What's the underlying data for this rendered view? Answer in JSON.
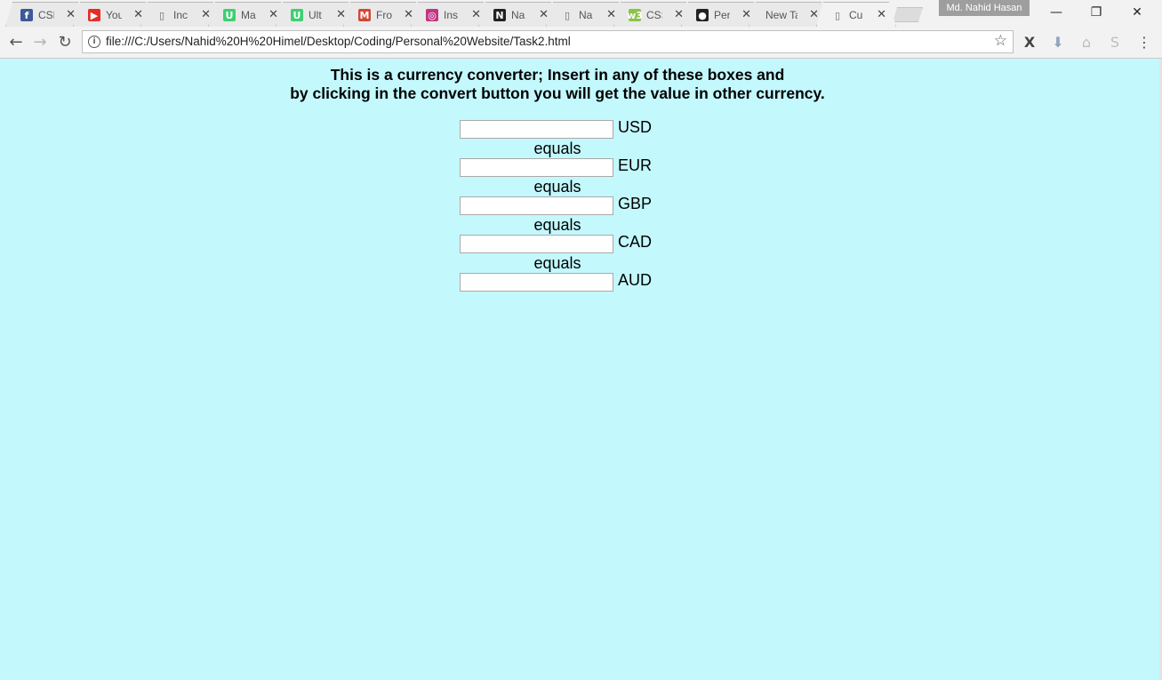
{
  "tabs": [
    {
      "title": "CSE",
      "favicon": "facebook-icon",
      "color": "#3b5998",
      "glyph": "f"
    },
    {
      "title": "You",
      "favicon": "youtube-icon",
      "color": "#e52d27",
      "glyph": "▶"
    },
    {
      "title": "Inc",
      "favicon": "page-icon",
      "color": "",
      "glyph": "▯"
    },
    {
      "title": "Ma",
      "favicon": "udemy-icon",
      "color": "#3fcf72",
      "glyph": "U"
    },
    {
      "title": "Ult",
      "favicon": "udemy-icon",
      "color": "#3fcf72",
      "glyph": "U"
    },
    {
      "title": "Fro",
      "favicon": "gmail-icon",
      "color": "#d44638",
      "glyph": "M"
    },
    {
      "title": "Ins",
      "favicon": "instagram-icon",
      "color": "#c13584",
      "glyph": "◎"
    },
    {
      "title": "Na",
      "favicon": "notion-icon",
      "color": "#222222",
      "glyph": "N"
    },
    {
      "title": "Na",
      "favicon": "page-icon",
      "color": "",
      "glyph": "▯"
    },
    {
      "title": "CSS",
      "favicon": "w3schools-icon",
      "color": "#8bc34a",
      "glyph": "w3"
    },
    {
      "title": "Per",
      "favicon": "github-icon",
      "color": "#222222",
      "glyph": "●"
    },
    {
      "title": "New Tab",
      "favicon": "",
      "color": "",
      "glyph": ""
    },
    {
      "title": "Cu",
      "favicon": "page-icon",
      "color": "",
      "glyph": "▯",
      "active": true
    }
  ],
  "profile_name": "Md. Nahid Hasan",
  "window": {
    "minimize": "—",
    "restore": "❐",
    "close": "✕"
  },
  "toolbar": {
    "back": "←",
    "forward": "→",
    "reload": "↻",
    "url": "file:///C:/Users/Nahid%20H%20Himel/Desktop/Coding/Personal%20Website/Task2.html",
    "star": "☆",
    "menu": "⋮"
  },
  "page": {
    "heading_line1": "This is a currency converter; Insert in any of these boxes and",
    "heading_line2": "by clicking in the convert button you will get the value in other currency.",
    "currencies": [
      "USD",
      "EUR",
      "GBP",
      "CAD",
      "AUD"
    ],
    "separator": "equals",
    "background": "#c3f8fd"
  }
}
